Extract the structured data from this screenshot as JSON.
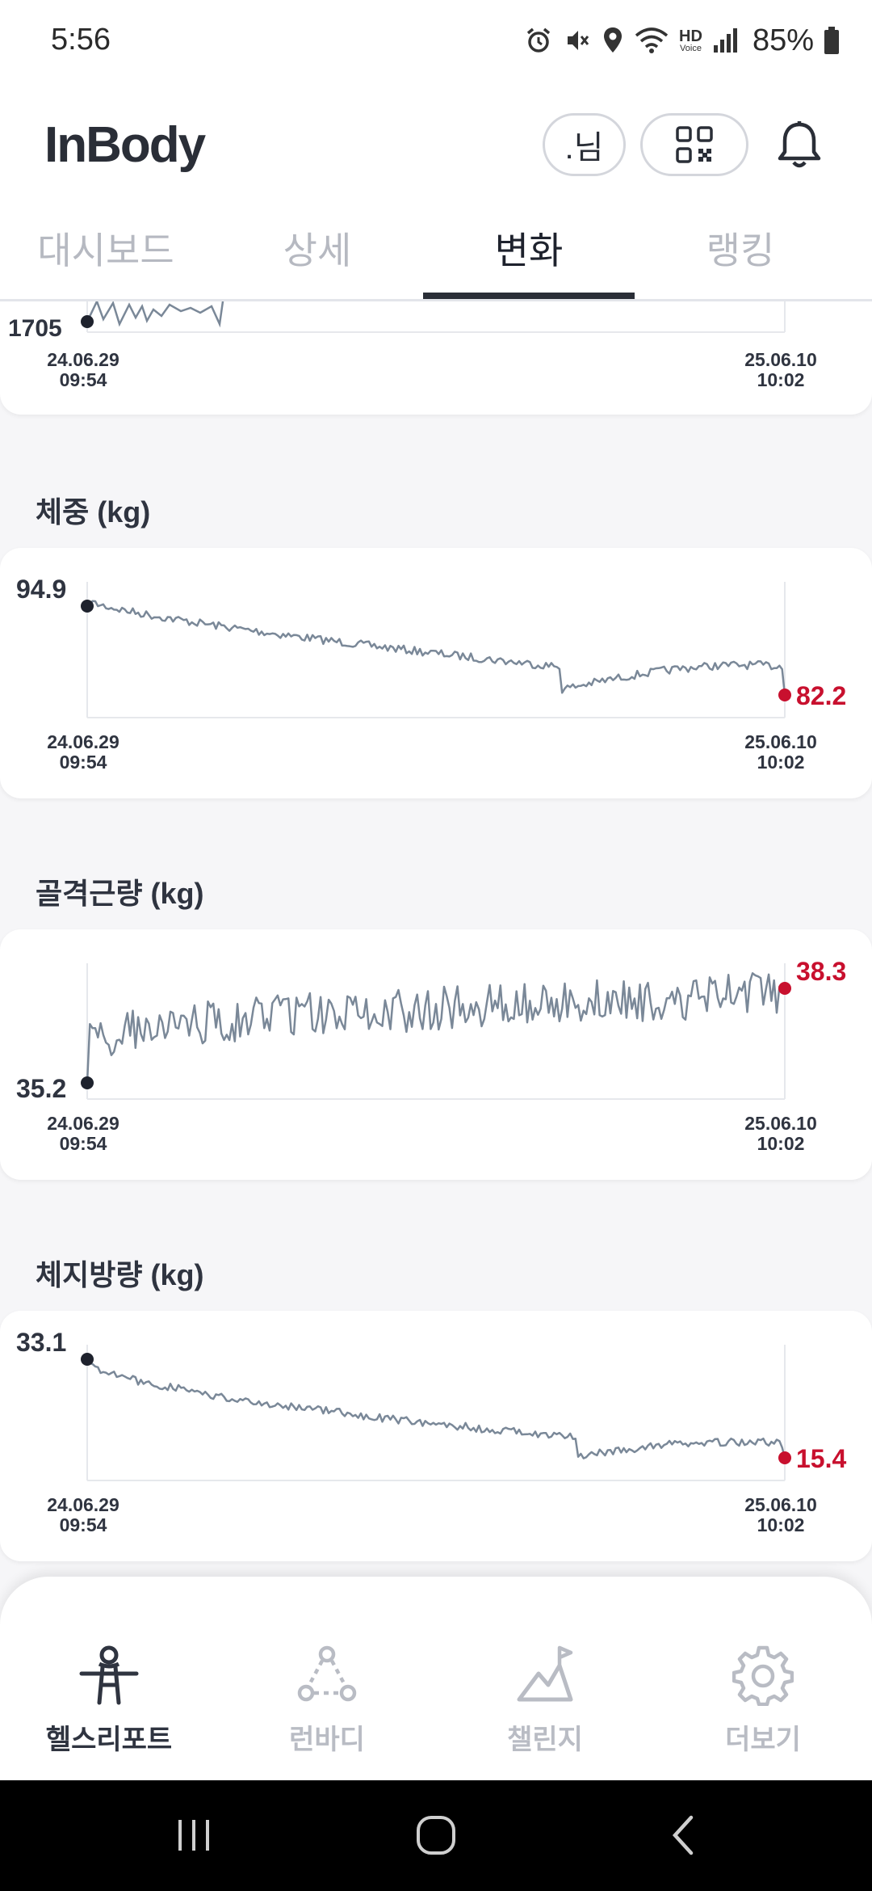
{
  "status_bar": {
    "time": "5:56",
    "hd_label": "HD",
    "voice_label": "Voice",
    "battery": "85%"
  },
  "header": {
    "logo": "InBody",
    "user_chip": ".님"
  },
  "tabs": [
    {
      "label": "대시보드",
      "active": false
    },
    {
      "label": "상세",
      "active": false
    },
    {
      "label": "변화",
      "active": true
    },
    {
      "label": "랭킹",
      "active": false
    }
  ],
  "top_partial_card": {
    "start_value": "1705",
    "start_date": "24.06.29",
    "start_time": "09:54",
    "end_date": "25.06.10",
    "end_time": "10:02"
  },
  "sections": [
    {
      "title": "체중 (kg)",
      "start_value": "94.9",
      "end_value": "82.2",
      "start_date": "24.06.29",
      "start_time": "09:54",
      "end_date": "25.06.10",
      "end_time": "10:02"
    },
    {
      "title": "골격근량 (kg)",
      "start_value": "35.2",
      "end_value": "38.3",
      "start_date": "24.06.29",
      "start_time": "09:54",
      "end_date": "25.06.10",
      "end_time": "10:02"
    },
    {
      "title": "체지방량 (kg)",
      "start_value": "33.1",
      "end_value": "15.4",
      "start_date": "24.06.29",
      "start_time": "09:54",
      "end_date": "25.06.10",
      "end_time": "10:02"
    }
  ],
  "bottom_nav": [
    {
      "label": "헬스리포트",
      "icon": "person-icon",
      "active": true
    },
    {
      "label": "런바디",
      "icon": "community-icon",
      "active": false
    },
    {
      "label": "챌린지",
      "icon": "flag-mountain-icon",
      "active": false
    },
    {
      "label": "더보기",
      "icon": "gear-icon",
      "active": false
    }
  ],
  "colors": {
    "accent_red": "#c8102e",
    "line_gray": "#7a8898",
    "dot_dark": "#1e222d"
  }
}
